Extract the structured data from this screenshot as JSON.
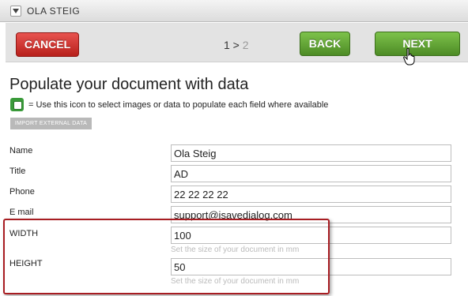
{
  "header": {
    "title": "OLA STEIG",
    "menu_icon": "triangle-down-icon"
  },
  "nav": {
    "cancel_label": "CANCEL",
    "step_current": "1",
    "step_sep": " > ",
    "step_next": "2",
    "back_label": "BACK",
    "next_label": "NEXT",
    "cancel_color": "#c9302c",
    "green_color": "#5aa531"
  },
  "main": {
    "heading": "Populate your document with data",
    "help_icon": "green-select-icon",
    "help_text": "= Use this icon to select images or data to populate each field where available",
    "import_label": "IMPORT EXTERNAL DATA"
  },
  "form": {
    "name_label": "Name",
    "name_value": "Ola Steig",
    "title_label": "Title",
    "title_value": "AD",
    "phone_label": "Phone",
    "phone_value": "22 22 22 22",
    "email_label": "E mail",
    "email_value": "support@isavedialog.com",
    "width_label": "WIDTH",
    "width_value": "100",
    "width_hint": "Set the size of your document in mm",
    "height_label": "HEIGHT",
    "height_value": "50",
    "height_hint": "Set the size of your document in mm"
  },
  "annotation": {
    "border_color": "#a81d22"
  }
}
